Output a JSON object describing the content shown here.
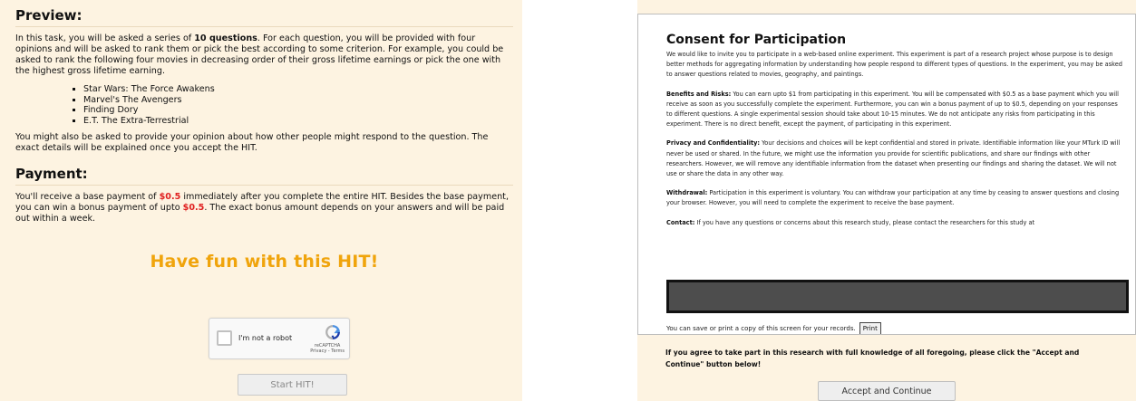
{
  "preview": {
    "title": "Preview:",
    "intro_1": "In this task, you will be asked a series of ",
    "intro_bold": "10 questions",
    "intro_2": ". For each question, you will be provided with four opinions and will be asked to rank them or pick the best according to some criterion. For example, you could be asked to rank the following four movies in decreasing order of their gross lifetime earnings or pick the one with the highest gross lifetime earning.",
    "movies": [
      "Star Wars: The Force Awakens",
      "Marvel's The Avengers",
      "Finding Dory",
      "E.T. The Extra-Terrestrial"
    ],
    "outro": "You might also be asked to provide your opinion about how other people might respond to the question. The exact details will be explained once you accept the HIT."
  },
  "payment": {
    "title": "Payment:",
    "text_1": "You'll receive a base payment of ",
    "base": "$0.5",
    "text_2": " immediately after you complete the entire HIT. Besides the base payment, you can win a bonus payment of upto ",
    "bonus": "$0.5",
    "text_3": ". The exact bonus amount depends on your answers and will be paid out within a week."
  },
  "fun_text": "Have fun with this HIT!",
  "captcha": {
    "label": "I'm not a robot",
    "brand": "reCAPTCHA",
    "links": "Privacy - Terms",
    "icon": "recaptcha-icon"
  },
  "start_button": "Start HIT!",
  "consent": {
    "title": "Consent for Participation",
    "intro": "We would like to invite you to participate in a web-based online experiment. This experiment is part of a research project whose purpose is to design better methods for aggregating information by understanding how people respond to different types of questions. In the experiment, you may be asked to answer questions related to movies, geography, and paintings.",
    "benefits_label": "Benefits and Risks:",
    "benefits_text": " You can earn upto $1 from participating in this experiment. You will be compensated with $0.5 as a base payment which you will receive as soon as you successfully complete the experiment. Furthermore, you can win a bonus payment of up to $0.5, depending on your responses to different questions. A single experimental session should take about 10-15 minutes. We do not anticipate any risks from participating in this experiment. There is no direct benefit, except the payment, of participating in this experiment.",
    "privacy_label": "Privacy and Confidentiality:",
    "privacy_text": " Your decisions and choices will be kept confidential and stored in private. Identifiable information like your MTurk ID will never be used or shared. In the future, we might use the information you provide for scientific publications, and share our findings with other researchers. However, we will remove any identifiable information from the dataset when presenting our findings and sharing the dataset. We will not use or share the data in any other way.",
    "withdrawal_label": "Withdrawal:",
    "withdrawal_text": " Participation in this experiment is voluntary. You can withdraw your participation at any time by ceasing to answer questions and closing your browser. However, you will need to complete the experiment to receive the base payment.",
    "contact_label": "Contact:",
    "contact_text": " If you have any questions or concerns about this research study, please contact the researchers for this study at",
    "save_text": "You can save or print a copy of this screen for your records.",
    "print_button": "Print"
  },
  "agree_text": "If you agree to take part in this research with full knowledge of all foregoing, please click the \"Accept and Continue\" button below!",
  "accept_button": "Accept and Continue",
  "colors": {
    "panel_bg": "#fdf3e1",
    "accent_orange": "#f0a40c",
    "payment_red": "#e02020"
  }
}
